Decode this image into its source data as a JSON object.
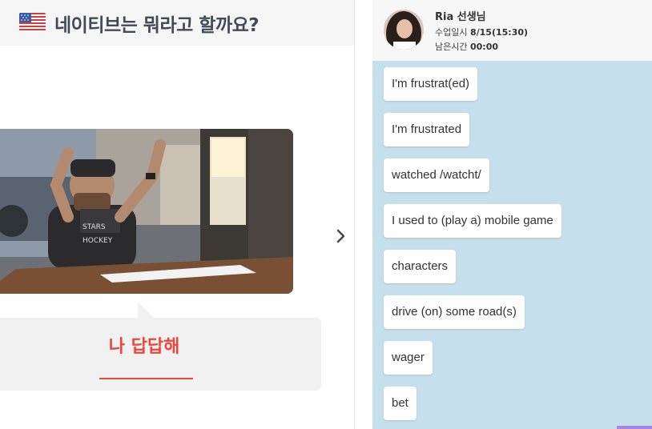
{
  "header": {
    "title": "네이티브는 뭐라고 할까요?"
  },
  "card": {
    "answer": "나 답답해"
  },
  "teacher": {
    "name": "Ria 선생님",
    "class_time_label": "수업일시",
    "class_time_value": "8/15(15:30)",
    "remaining_label": "남은시간",
    "remaining_value": "00:00"
  },
  "chat": {
    "messages": [
      "I'm frustrat(ed)",
      "I'm frustrated",
      "watched /watcht/",
      "I used to (play a) mobile game",
      "characters",
      "drive (on) some road(s)",
      "wager",
      "bet"
    ]
  },
  "colors": {
    "accent_red": "#e8473a",
    "chat_background": "#c5dfec",
    "scroll_accent": "#a784e6"
  },
  "icons": [
    "us-flag-icon",
    "chevron-right-icon"
  ]
}
